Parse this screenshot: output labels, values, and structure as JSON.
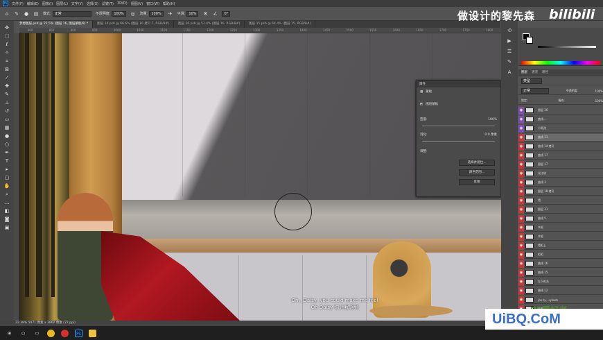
{
  "menubar": {
    "items": [
      "文件(F)",
      "编辑(E)",
      "图像(I)",
      "图层(L)",
      "文字(Y)",
      "选择(S)",
      "滤镜(T)",
      "3D(D)",
      "视图(V)",
      "窗口(W)",
      "帮助(H)"
    ]
  },
  "options": {
    "mode_label": "模式:",
    "mode_value": "正常",
    "opacity_label": "不透明度:",
    "opacity_value": "100%",
    "flow_label": "流量:",
    "flow_value": "100%",
    "smooth_label": "平滑:",
    "smooth_value": "10%",
    "angle_value": "0°"
  },
  "branding": {
    "text": "做设计的黎先森",
    "logo": "bilibili"
  },
  "tabs": [
    {
      "label": "梦想图层.psd @ 22.5% (图层 16, 图层蒙板/8) *",
      "active": true
    },
    {
      "label": "图层 14.psb @ 66.6% (图层 16 拷贝 7, RGB/8#)",
      "active": false
    },
    {
      "label": "图层 16.psb @ 51.4% (图层 16, RGB/8#)",
      "active": false
    },
    {
      "label": "图层 15.psb @ 64.4% (图层 15, RGB/8#)",
      "active": false
    }
  ],
  "ruler": [
    "800",
    "850",
    "900",
    "950",
    "1000",
    "1050",
    "1100",
    "1150",
    "1200",
    "1250",
    "1300",
    "1350",
    "1400",
    "1450",
    "1500",
    "1550",
    "1600",
    "1650",
    "1700",
    "1750",
    "1800"
  ],
  "properties": {
    "title": "属性",
    "subtitle": "蒙板",
    "mask_label": "图层蒙板",
    "density_label": "密度:",
    "density_value": "100%",
    "feather_label": "羽化:",
    "feather_value": "0.0 像素",
    "adjust_label": "调整:",
    "btn_select": "选择并遮住...",
    "btn_color": "颜色范围...",
    "btn_invert": "反相"
  },
  "subtitle": {
    "line1": "Oh，Daisy, you could make me feel",
    "line2": "Oh Daisy 你让我感到"
  },
  "layers_panel": {
    "tabs": [
      "图层",
      "通道",
      "路径"
    ],
    "kind": "类型",
    "blend": "正常",
    "opacity_label": "不透明度:",
    "opacity_value": "100%",
    "lock_label": "锁定:",
    "fill_label": "填充:",
    "fill_value": "100%",
    "rows": [
      "图层 36",
      "曲线...",
      "小男孩",
      "曲线 11",
      "曲线 14 拷贝",
      "曲线 17",
      "图层 17",
      "光比较",
      "曲线 3",
      "图层 18 拷贝",
      "墙",
      "图层 31",
      "曲线 5",
      "木框",
      "木框",
      "墙柜上",
      "柜柜",
      "曲线 16",
      "曲线 15",
      "左下柜台",
      "曲线 12",
      "jon-ty...-splash",
      "木框"
    ]
  },
  "status": {
    "text": "22.39%   5071 像素 x 3860 像素 (72 ppi)"
  },
  "watermark": {
    "text": "UiBQ.CoM",
    "sub": "PS爱好者"
  },
  "taskbar": {
    "icons": [
      "start-icon",
      "search-icon",
      "task-view-icon",
      "chrome-icon",
      "netease-icon",
      "photoshop-icon",
      "explorer-icon"
    ]
  },
  "colors": {
    "accent": "#31a8ff",
    "cape": "#b21822",
    "wood": "#d09c50"
  }
}
